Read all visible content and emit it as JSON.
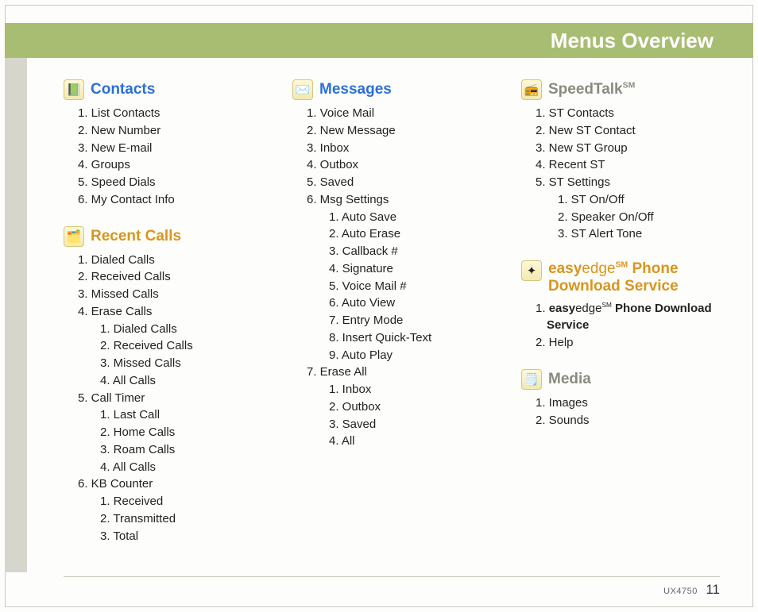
{
  "header": {
    "title": "Menus Overview"
  },
  "footer": {
    "model": "UX4750",
    "page": "11"
  },
  "contacts": {
    "title": "Contacts",
    "items": [
      "1. List Contacts",
      "2. New Number",
      "3. New E-mail",
      "4. Groups",
      "5. Speed Dials",
      "6. My Contact Info"
    ]
  },
  "recent": {
    "title": "Recent Calls",
    "items": [
      "1. Dialed Calls",
      "2. Received Calls",
      "3. Missed Calls",
      "4. Erase Calls"
    ],
    "erase_sub": [
      "1. Dialed Calls",
      "2. Received Calls",
      "3. Missed Calls",
      "4. All Calls"
    ],
    "timer_head": "5. Call Timer",
    "timer_sub": [
      "1. Last Call",
      "2. Home Calls",
      "3. Roam Calls",
      "4. All Calls"
    ],
    "kb_head": "6. KB Counter",
    "kb_sub": [
      "1. Received",
      "2. Transmitted",
      "3. Total"
    ]
  },
  "messages": {
    "title": "Messages",
    "items": [
      "1. Voice Mail",
      "2. New Message",
      "3. Inbox",
      "4. Outbox",
      "5. Saved",
      "6. Msg Settings"
    ],
    "settings_sub": [
      "1. Auto Save",
      "2. Auto Erase",
      "3. Callback #",
      "4. Signature",
      "5. Voice Mail #",
      "6. Auto View",
      "7. Entry Mode",
      "8. Insert Quick-Text",
      "9. Auto Play"
    ],
    "erase_head": "7. Erase All",
    "erase_sub": [
      "1. Inbox",
      "2. Outbox",
      "3. Saved",
      "4. All"
    ]
  },
  "speedtalk": {
    "title_a": "SpeedTalk",
    "title_sm": "SM",
    "items": [
      "1. ST Contacts",
      "2. New ST Contact",
      "3. New ST Group",
      "4. Recent ST",
      "5. ST Settings"
    ],
    "settings_sub": [
      "1. ST On/Off",
      "2. Speaker On/Off",
      "3. ST Alert Tone"
    ]
  },
  "easy": {
    "t_easy": "easy",
    "t_edge": "edge",
    "t_sm": "SM",
    "t_rest1": "Phone",
    "t_rest2": "Download Service",
    "item1_a": "easy",
    "item1_b": "edge",
    "item1_sm": "SM",
    "item1_c": " Phone Download",
    "item1_d": "Service",
    "item2": "2. Help"
  },
  "media": {
    "title": "Media",
    "items": [
      "1. Images",
      "2. Sounds"
    ]
  }
}
